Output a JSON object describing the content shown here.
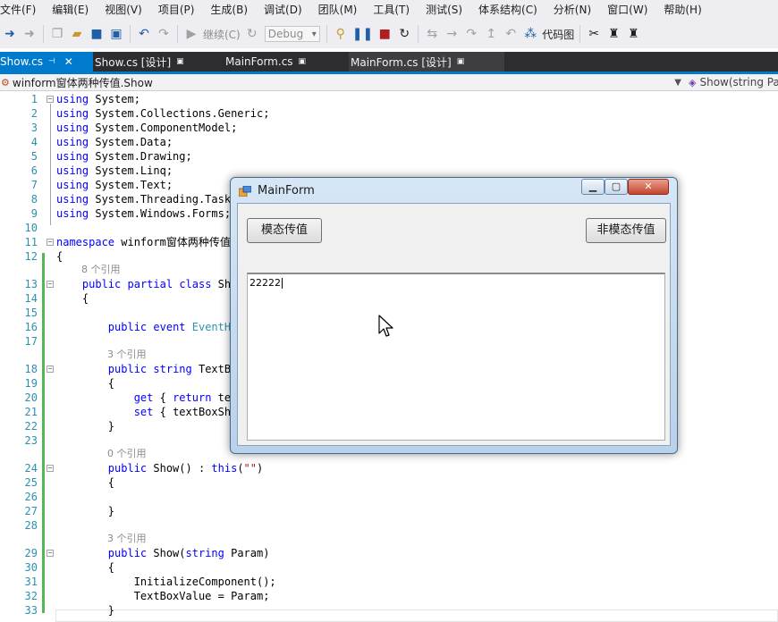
{
  "menu": [
    "文件(F)",
    "编辑(E)",
    "视图(V)",
    "项目(P)",
    "生成(B)",
    "调试(D)",
    "团队(M)",
    "工具(T)",
    "测试(S)",
    "体系结构(C)",
    "分析(N)",
    "窗口(W)",
    "帮助(H)"
  ],
  "toolbar": {
    "continue_label": "继续(C)",
    "config_value": "Debug",
    "codemap_label": "代码图"
  },
  "tabs": [
    {
      "label": "Show.cs",
      "active": true
    },
    {
      "label": "Show.cs [设计]",
      "active": false
    },
    {
      "label": "MainForm.cs",
      "active": false
    },
    {
      "label": "MainForm.cs [设计]",
      "active": false
    }
  ],
  "navbar": {
    "type_path": "winform窗体两种传值.Show",
    "member": "Show(string Pa"
  },
  "code_lines": [
    {
      "n": "1",
      "t": "using System;"
    },
    {
      "n": "2",
      "t": "using System.Collections.Generic;"
    },
    {
      "n": "3",
      "t": "using System.ComponentModel;"
    },
    {
      "n": "4",
      "t": "using System.Data;"
    },
    {
      "n": "5",
      "t": "using System.Drawing;"
    },
    {
      "n": "6",
      "t": "using System.Linq;"
    },
    {
      "n": "7",
      "t": "using System.Text;"
    },
    {
      "n": "8",
      "t": "using System.Threading.Tasks;"
    },
    {
      "n": "9",
      "t": "using System.Windows.Forms;"
    },
    {
      "n": "10",
      "t": ""
    },
    {
      "n": "11",
      "t": "namespace winform窗体两种传值"
    },
    {
      "n": "12",
      "t": "{"
    },
    {
      "n": "13",
      "t": "    public partial class Show"
    },
    {
      "n": "14",
      "t": "    {"
    },
    {
      "n": "15",
      "t": ""
    },
    {
      "n": "16",
      "t": "        public event EventHa"
    },
    {
      "n": "17",
      "t": ""
    },
    {
      "n": "18",
      "t": "        public string TextBo"
    },
    {
      "n": "19",
      "t": "        {"
    },
    {
      "n": "20",
      "t": "            get { return tex"
    },
    {
      "n": "21",
      "t": "            set { textBoxSho"
    },
    {
      "n": "22",
      "t": "        }"
    },
    {
      "n": "23",
      "t": ""
    },
    {
      "n": "24",
      "t": "        public Show() : this(\"\")"
    },
    {
      "n": "25",
      "t": "        {"
    },
    {
      "n": "26",
      "t": ""
    },
    {
      "n": "27",
      "t": "        }"
    },
    {
      "n": "28",
      "t": ""
    },
    {
      "n": "29",
      "t": "        public Show(string Param)"
    },
    {
      "n": "30",
      "t": "        {"
    },
    {
      "n": "31",
      "t": "            InitializeComponent();"
    },
    {
      "n": "32",
      "t": "            TextBoxValue = Param;"
    },
    {
      "n": "33",
      "t": "        }"
    }
  ],
  "refs": {
    "class_refs": "8 个引用",
    "prop_refs": "3 个引用",
    "ctor0_refs": "0 个引用",
    "ctor1_refs": "3 个引用"
  },
  "dialog": {
    "title": "MainForm",
    "modal_button": "模态传值",
    "modeless_button": "非模态传值",
    "textbox_value": "22222"
  },
  "colors": {
    "accent": "#007acc",
    "keyword": "#0000ff",
    "type": "#2b91af",
    "line_number": "#2b91af",
    "changed_margin": "#56b656"
  }
}
